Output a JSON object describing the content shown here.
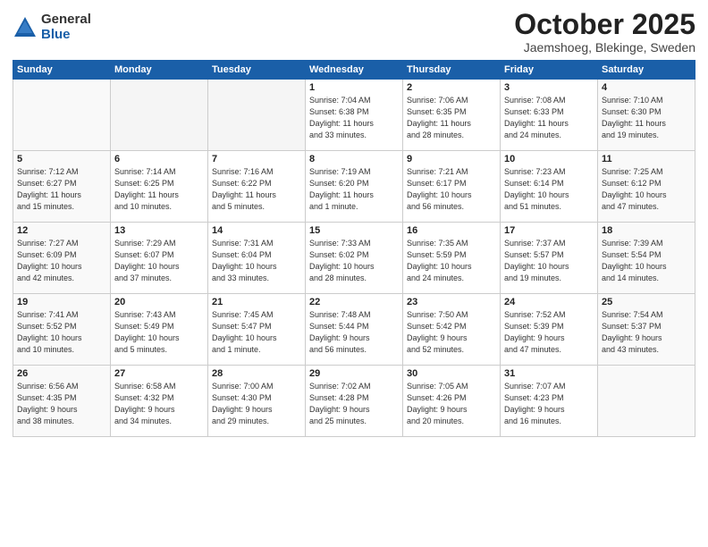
{
  "logo": {
    "general": "General",
    "blue": "Blue"
  },
  "title": "October 2025",
  "subtitle": "Jaemshoeg, Blekinge, Sweden",
  "days_of_week": [
    "Sunday",
    "Monday",
    "Tuesday",
    "Wednesday",
    "Thursday",
    "Friday",
    "Saturday"
  ],
  "weeks": [
    [
      {
        "day": "",
        "info": ""
      },
      {
        "day": "",
        "info": ""
      },
      {
        "day": "",
        "info": ""
      },
      {
        "day": "1",
        "info": "Sunrise: 7:04 AM\nSunset: 6:38 PM\nDaylight: 11 hours\nand 33 minutes."
      },
      {
        "day": "2",
        "info": "Sunrise: 7:06 AM\nSunset: 6:35 PM\nDaylight: 11 hours\nand 28 minutes."
      },
      {
        "day": "3",
        "info": "Sunrise: 7:08 AM\nSunset: 6:33 PM\nDaylight: 11 hours\nand 24 minutes."
      },
      {
        "day": "4",
        "info": "Sunrise: 7:10 AM\nSunset: 6:30 PM\nDaylight: 11 hours\nand 19 minutes."
      }
    ],
    [
      {
        "day": "5",
        "info": "Sunrise: 7:12 AM\nSunset: 6:27 PM\nDaylight: 11 hours\nand 15 minutes."
      },
      {
        "day": "6",
        "info": "Sunrise: 7:14 AM\nSunset: 6:25 PM\nDaylight: 11 hours\nand 10 minutes."
      },
      {
        "day": "7",
        "info": "Sunrise: 7:16 AM\nSunset: 6:22 PM\nDaylight: 11 hours\nand 5 minutes."
      },
      {
        "day": "8",
        "info": "Sunrise: 7:19 AM\nSunset: 6:20 PM\nDaylight: 11 hours\nand 1 minute."
      },
      {
        "day": "9",
        "info": "Sunrise: 7:21 AM\nSunset: 6:17 PM\nDaylight: 10 hours\nand 56 minutes."
      },
      {
        "day": "10",
        "info": "Sunrise: 7:23 AM\nSunset: 6:14 PM\nDaylight: 10 hours\nand 51 minutes."
      },
      {
        "day": "11",
        "info": "Sunrise: 7:25 AM\nSunset: 6:12 PM\nDaylight: 10 hours\nand 47 minutes."
      }
    ],
    [
      {
        "day": "12",
        "info": "Sunrise: 7:27 AM\nSunset: 6:09 PM\nDaylight: 10 hours\nand 42 minutes."
      },
      {
        "day": "13",
        "info": "Sunrise: 7:29 AM\nSunset: 6:07 PM\nDaylight: 10 hours\nand 37 minutes."
      },
      {
        "day": "14",
        "info": "Sunrise: 7:31 AM\nSunset: 6:04 PM\nDaylight: 10 hours\nand 33 minutes."
      },
      {
        "day": "15",
        "info": "Sunrise: 7:33 AM\nSunset: 6:02 PM\nDaylight: 10 hours\nand 28 minutes."
      },
      {
        "day": "16",
        "info": "Sunrise: 7:35 AM\nSunset: 5:59 PM\nDaylight: 10 hours\nand 24 minutes."
      },
      {
        "day": "17",
        "info": "Sunrise: 7:37 AM\nSunset: 5:57 PM\nDaylight: 10 hours\nand 19 minutes."
      },
      {
        "day": "18",
        "info": "Sunrise: 7:39 AM\nSunset: 5:54 PM\nDaylight: 10 hours\nand 14 minutes."
      }
    ],
    [
      {
        "day": "19",
        "info": "Sunrise: 7:41 AM\nSunset: 5:52 PM\nDaylight: 10 hours\nand 10 minutes."
      },
      {
        "day": "20",
        "info": "Sunrise: 7:43 AM\nSunset: 5:49 PM\nDaylight: 10 hours\nand 5 minutes."
      },
      {
        "day": "21",
        "info": "Sunrise: 7:45 AM\nSunset: 5:47 PM\nDaylight: 10 hours\nand 1 minute."
      },
      {
        "day": "22",
        "info": "Sunrise: 7:48 AM\nSunset: 5:44 PM\nDaylight: 9 hours\nand 56 minutes."
      },
      {
        "day": "23",
        "info": "Sunrise: 7:50 AM\nSunset: 5:42 PM\nDaylight: 9 hours\nand 52 minutes."
      },
      {
        "day": "24",
        "info": "Sunrise: 7:52 AM\nSunset: 5:39 PM\nDaylight: 9 hours\nand 47 minutes."
      },
      {
        "day": "25",
        "info": "Sunrise: 7:54 AM\nSunset: 5:37 PM\nDaylight: 9 hours\nand 43 minutes."
      }
    ],
    [
      {
        "day": "26",
        "info": "Sunrise: 6:56 AM\nSunset: 4:35 PM\nDaylight: 9 hours\nand 38 minutes."
      },
      {
        "day": "27",
        "info": "Sunrise: 6:58 AM\nSunset: 4:32 PM\nDaylight: 9 hours\nand 34 minutes."
      },
      {
        "day": "28",
        "info": "Sunrise: 7:00 AM\nSunset: 4:30 PM\nDaylight: 9 hours\nand 29 minutes."
      },
      {
        "day": "29",
        "info": "Sunrise: 7:02 AM\nSunset: 4:28 PM\nDaylight: 9 hours\nand 25 minutes."
      },
      {
        "day": "30",
        "info": "Sunrise: 7:05 AM\nSunset: 4:26 PM\nDaylight: 9 hours\nand 20 minutes."
      },
      {
        "day": "31",
        "info": "Sunrise: 7:07 AM\nSunset: 4:23 PM\nDaylight: 9 hours\nand 16 minutes."
      },
      {
        "day": "",
        "info": ""
      }
    ]
  ]
}
